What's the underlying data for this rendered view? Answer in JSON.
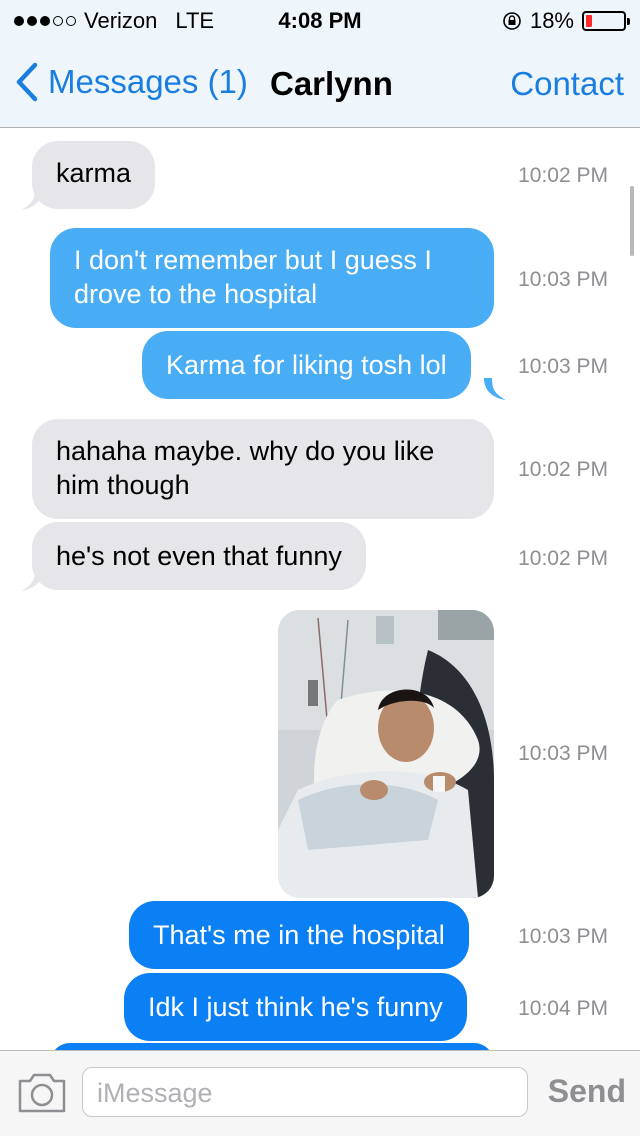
{
  "status_bar": {
    "carrier": "Verizon",
    "network": "LTE",
    "time": "4:08 PM",
    "battery_percent": "18%",
    "battery_level": 0.18,
    "signal_bars": 3,
    "signal_total": 5
  },
  "nav": {
    "back_label": "Messages (1)",
    "title": "Carlynn",
    "right_label": "Contact"
  },
  "messages": [
    {
      "text": "karma",
      "time": "10:02 PM",
      "direction": "incoming"
    },
    {
      "text": "I don't remember but I guess I drove to the hospital",
      "time": "10:03 PM",
      "direction": "outgoing"
    },
    {
      "text": "Karma for liking tosh lol",
      "time": "10:03 PM",
      "direction": "outgoing"
    },
    {
      "text": "hahaha maybe. why do you like him though",
      "time": "10:02 PM",
      "direction": "incoming"
    },
    {
      "text": "he's not even that funny",
      "time": "10:02 PM",
      "direction": "incoming"
    },
    {
      "type": "image",
      "time": "10:03 PM",
      "direction": "outgoing"
    },
    {
      "text": "That's me in the hospital",
      "time": "10:03 PM",
      "direction": "outgoing"
    },
    {
      "text": "Idk I just think he's funny",
      "time": "10:04 PM",
      "direction": "outgoing"
    }
  ],
  "input": {
    "placeholder": "iMessage",
    "send_label": "Send"
  },
  "colors": {
    "imessage_blue": "#0b7ff4",
    "light_blue": "#49adf5",
    "incoming_gray": "#e5e5ea",
    "ios_tint": "#1a7ee0",
    "battery_red": "#ff2a2a"
  },
  "icons": [
    "chevron-left-icon",
    "camera-icon",
    "battery-icon",
    "signal-dots-icon",
    "lock-rotation-icon"
  ]
}
